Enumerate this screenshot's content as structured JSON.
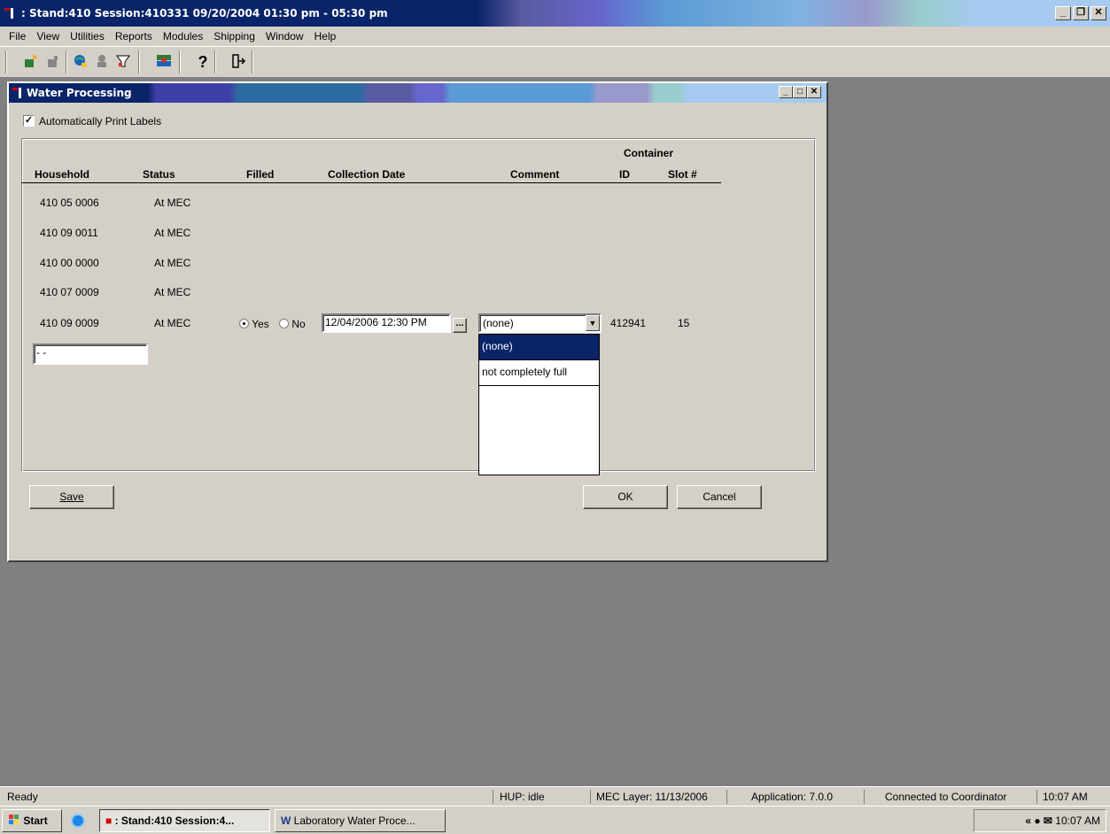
{
  "app": {
    "title": ": Stand:410 Session:410331 09/20/2004 01:30 pm - 05:30 pm",
    "window_controls": [
      "_",
      "&#x25A1;",
      "X"
    ]
  },
  "menu": [
    "File",
    "View",
    "Utilities",
    "Reports",
    "Modules",
    "Shipping",
    "Window",
    "Help"
  ],
  "toolbar": {
    "icons": [
      "new-icon",
      "open-icon",
      "globe-icon",
      "stamp-icon",
      "filter-icon",
      "people-icon",
      "help-icon",
      "exit-icon"
    ]
  },
  "dialog": {
    "title": "Water Processing",
    "auto_print_label": "Automatically Print Labels",
    "auto_print_checked": true,
    "columns": {
      "household": "Household",
      "status": "Status",
      "filled": "Filled",
      "collection_date": "Collection Date",
      "comment": "Comment",
      "container": "Container",
      "container_id": "ID",
      "slot": "Slot #"
    },
    "rows": [
      {
        "household": "410 05 0006",
        "status": "At MEC"
      },
      {
        "household": "410 09 0011",
        "status": "At MEC"
      },
      {
        "household": "410 00 0000",
        "status": "At MEC"
      },
      {
        "household": "410 07 0009",
        "status": "At MEC"
      },
      {
        "household": "410 09 0009",
        "status": "At MEC",
        "filled_yes": "Yes",
        "filled_no": "No",
        "collection_date": "12/04/2006 12:30 PM",
        "date_button": "...",
        "comment": "(none)",
        "container_id": "412941",
        "slot": "15"
      }
    ],
    "new_household_value": "- -",
    "comment_options": [
      "(none)",
      "not completely full"
    ],
    "buttons": {
      "save": "Save",
      "ok": "OK",
      "cancel": "Cancel"
    }
  },
  "statusbar": {
    "ready": "Ready",
    "hup": "HUP: idle",
    "mec_layer": "MEC Layer: 11/13/2006",
    "application": "Application: 7.0.0",
    "connection": "Connected to Coordinator",
    "time": "10:07 AM"
  },
  "taskbar": {
    "start": "Start",
    "task1": ": Stand:410 Session:4...",
    "task2": "Laboratory Water Proce...",
    "tray_time": "10:07 AM"
  }
}
